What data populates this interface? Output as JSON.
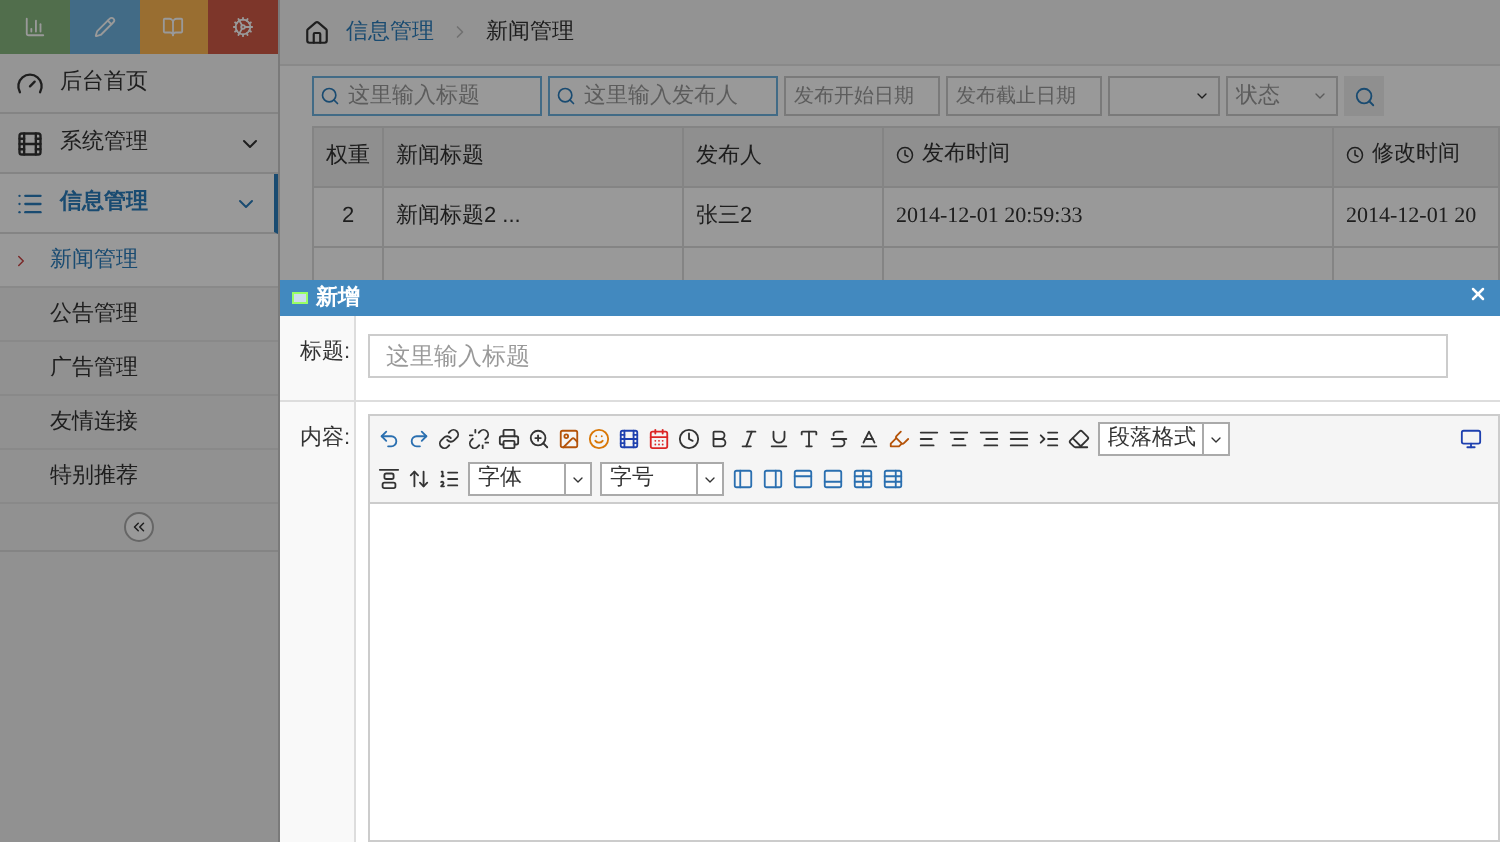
{
  "breadcrumb": [
    {
      "label": "信息管理"
    },
    {
      "label": "新闻管理"
    }
  ],
  "sidebar": {
    "items": [
      {
        "label": "后台首页",
        "selected": false
      },
      {
        "label": "系统管理",
        "expanded": false,
        "selected": false
      },
      {
        "label": "信息管理",
        "expanded": true,
        "selected": true,
        "children": [
          {
            "label": "新闻管理",
            "selected": true
          },
          {
            "label": "公告管理",
            "selected": false
          },
          {
            "label": "广告管理",
            "selected": false
          },
          {
            "label": "友情连接",
            "selected": false
          },
          {
            "label": "特别推荐",
            "selected": false
          }
        ]
      }
    ]
  },
  "filters": {
    "title_placeholder": "这里输入标题",
    "author_placeholder": "这里输入发布人",
    "start_placeholder": "发布开始日期",
    "end_placeholder": "发布截止日期",
    "status_placeholder": "状态"
  },
  "table": {
    "columns": [
      "权重",
      "新闻标题",
      "发布人",
      "发布时间",
      "修改时间"
    ],
    "rows": [
      [
        "2",
        "新闻标题2 ...",
        "张三2",
        "2014-12-01 20:59:33",
        "2014-12-01 20"
      ]
    ]
  },
  "dialog": {
    "title": "新增",
    "title_label": "标题:",
    "title_placeholder": "这里输入标题",
    "content_label": "内容:",
    "paragraph_select": "段落格式",
    "font_select": "字体",
    "size_select": "字号"
  }
}
